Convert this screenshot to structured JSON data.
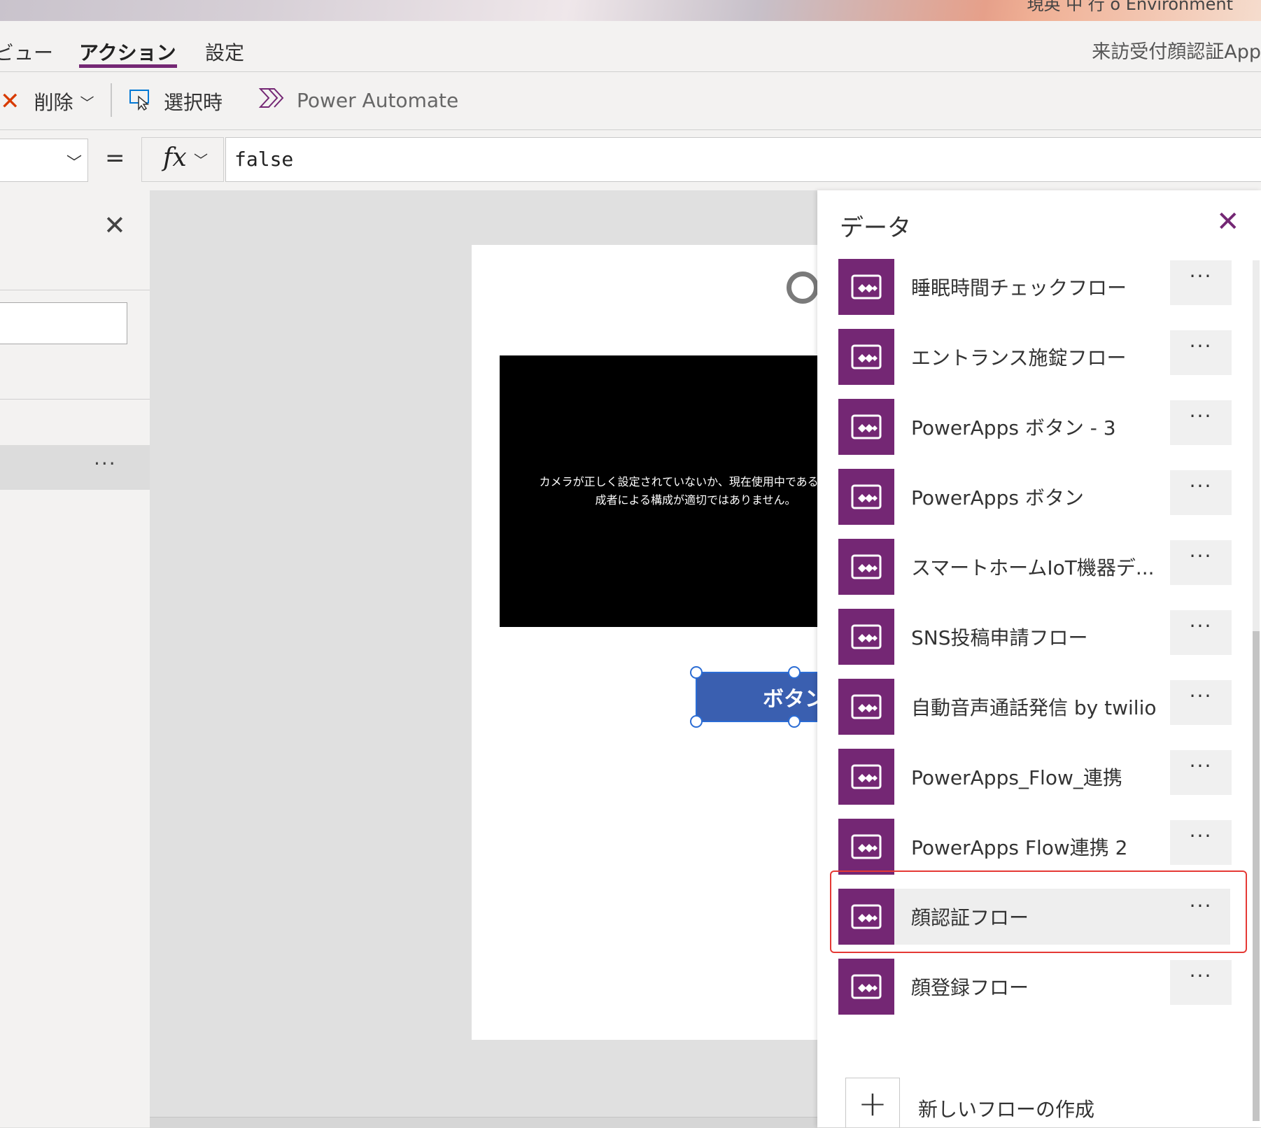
{
  "banner": {
    "right_text": "現英 中 行 o Environment"
  },
  "tabs": {
    "view": "ビュー",
    "action": "アクション",
    "settings": "設定"
  },
  "app_title": "来訪受付顔認証App",
  "toolbar": {
    "delete_label": "削除",
    "onselect_label": "選択時",
    "automate_label": "Power Automate"
  },
  "formula": {
    "equals": "=",
    "fx": "fx",
    "value": "false"
  },
  "left_panel": {
    "row_more": "···"
  },
  "canvas": {
    "camera_message_line1": "カメラが正しく設定されていないか、現在使用中であるか、ま",
    "camera_message_line2": "成者による構成が適切ではありません。",
    "button_label": "ボタン"
  },
  "data_pane": {
    "title": "データ",
    "flows": [
      {
        "label": "睡眠時間チェックフロー",
        "more": "···"
      },
      {
        "label": "エントランス施錠フロー",
        "more": "···"
      },
      {
        "label": "PowerApps ボタン - 3",
        "more": "···"
      },
      {
        "label": "PowerApps ボタン",
        "more": "···"
      },
      {
        "label": "スマートホームIoT機器デ...",
        "more": "···"
      },
      {
        "label": "SNS投稿申請フロー",
        "more": "···"
      },
      {
        "label": "自動音声通話発信 by twilio",
        "more": "···"
      },
      {
        "label": "PowerApps_Flow_連携",
        "more": "···"
      },
      {
        "label": "PowerApps Flow連携 2",
        "more": "···"
      },
      {
        "label": "顔認証フロー",
        "more": "···"
      },
      {
        "label": "顔登録フロー",
        "more": "···"
      }
    ],
    "selected_flow": "顔認証フロー",
    "new_flow_label": "新しいフローの作成"
  },
  "colors": {
    "accent": "#742774",
    "highlight": "#e53935",
    "button": "#3a5fb0"
  }
}
